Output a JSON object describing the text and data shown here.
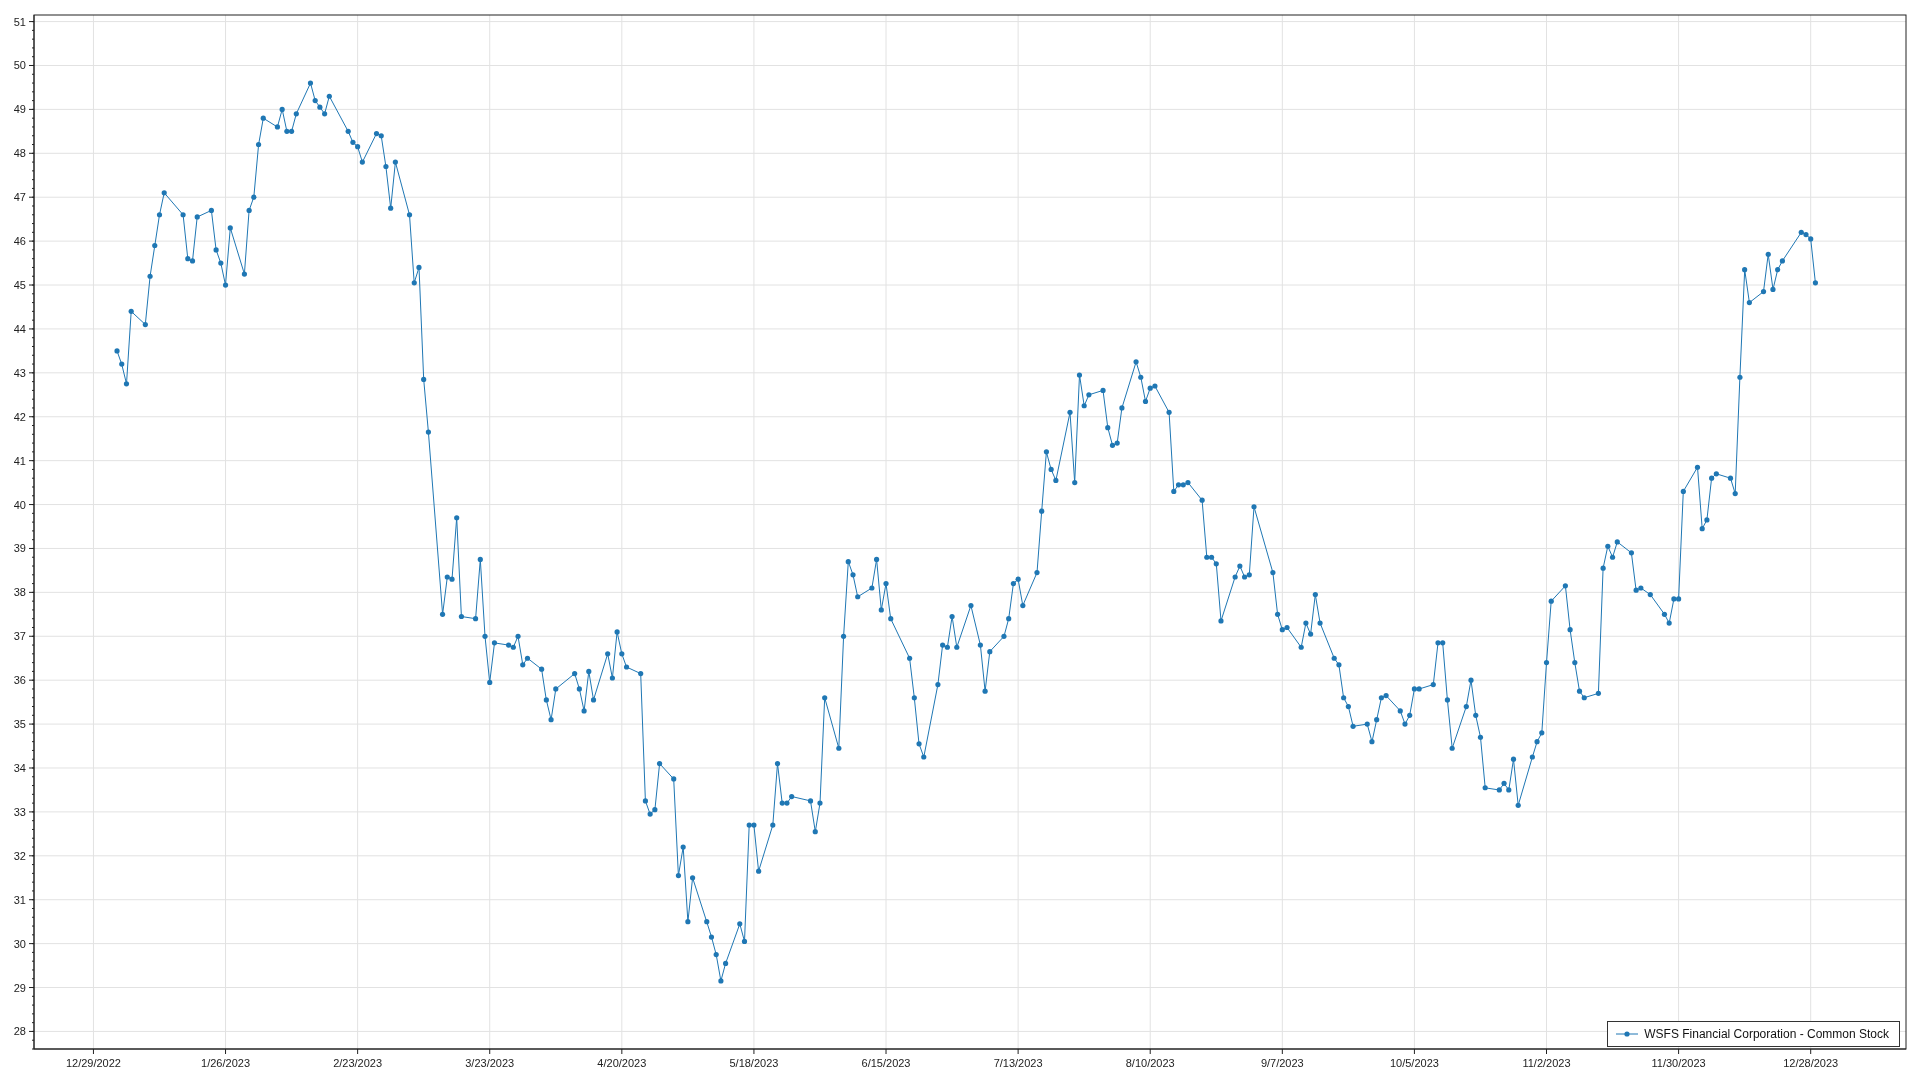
{
  "chart_data": {
    "type": "line",
    "x": [
      "2023-01-03",
      "2023-01-04",
      "2023-01-05",
      "2023-01-06",
      "2023-01-09",
      "2023-01-10",
      "2023-01-11",
      "2023-01-12",
      "2023-01-13",
      "2023-01-17",
      "2023-01-18",
      "2023-01-19",
      "2023-01-20",
      "2023-01-23",
      "2023-01-24",
      "2023-01-25",
      "2023-01-26",
      "2023-01-27",
      "2023-01-30",
      "2023-01-31",
      "2023-02-01",
      "2023-02-02",
      "2023-02-03",
      "2023-02-06",
      "2023-02-07",
      "2023-02-08",
      "2023-02-09",
      "2023-02-10",
      "2023-02-13",
      "2023-02-14",
      "2023-02-15",
      "2023-02-16",
      "2023-02-17",
      "2023-02-21",
      "2023-02-22",
      "2023-02-23",
      "2023-02-24",
      "2023-02-27",
      "2023-02-28",
      "2023-03-01",
      "2023-03-02",
      "2023-03-03",
      "2023-03-06",
      "2023-03-07",
      "2023-03-08",
      "2023-03-09",
      "2023-03-10",
      "2023-03-13",
      "2023-03-14",
      "2023-03-15",
      "2023-03-16",
      "2023-03-17",
      "2023-03-20",
      "2023-03-21",
      "2023-03-22",
      "2023-03-23",
      "2023-03-24",
      "2023-03-27",
      "2023-03-28",
      "2023-03-29",
      "2023-03-30",
      "2023-03-31",
      "2023-04-03",
      "2023-04-04",
      "2023-04-05",
      "2023-04-06",
      "2023-04-10",
      "2023-04-11",
      "2023-04-12",
      "2023-04-13",
      "2023-04-14",
      "2023-04-17",
      "2023-04-18",
      "2023-04-19",
      "2023-04-20",
      "2023-04-21",
      "2023-04-24",
      "2023-04-25",
      "2023-04-26",
      "2023-04-27",
      "2023-04-28",
      "2023-05-01",
      "2023-05-02",
      "2023-05-03",
      "2023-05-04",
      "2023-05-05",
      "2023-05-08",
      "2023-05-09",
      "2023-05-10",
      "2023-05-11",
      "2023-05-12",
      "2023-05-15",
      "2023-05-16",
      "2023-05-17",
      "2023-05-18",
      "2023-05-19",
      "2023-05-22",
      "2023-05-23",
      "2023-05-24",
      "2023-05-25",
      "2023-05-26",
      "2023-05-30",
      "2023-05-31",
      "2023-06-01",
      "2023-06-02",
      "2023-06-05",
      "2023-06-06",
      "2023-06-07",
      "2023-06-08",
      "2023-06-09",
      "2023-06-12",
      "2023-06-13",
      "2023-06-14",
      "2023-06-15",
      "2023-06-16",
      "2023-06-20",
      "2023-06-21",
      "2023-06-22",
      "2023-06-23",
      "2023-06-26",
      "2023-06-27",
      "2023-06-28",
      "2023-06-29",
      "2023-06-30",
      "2023-07-03",
      "2023-07-05",
      "2023-07-06",
      "2023-07-07",
      "2023-07-10",
      "2023-07-11",
      "2023-07-12",
      "2023-07-13",
      "2023-07-14",
      "2023-07-17",
      "2023-07-18",
      "2023-07-19",
      "2023-07-20",
      "2023-07-21",
      "2023-07-24",
      "2023-07-25",
      "2023-07-26",
      "2023-07-27",
      "2023-07-28",
      "2023-07-31",
      "2023-08-01",
      "2023-08-02",
      "2023-08-03",
      "2023-08-04",
      "2023-08-07",
      "2023-08-08",
      "2023-08-09",
      "2023-08-10",
      "2023-08-11",
      "2023-08-14",
      "2023-08-15",
      "2023-08-16",
      "2023-08-17",
      "2023-08-18",
      "2023-08-21",
      "2023-08-22",
      "2023-08-23",
      "2023-08-24",
      "2023-08-25",
      "2023-08-28",
      "2023-08-29",
      "2023-08-30",
      "2023-08-31",
      "2023-09-01",
      "2023-09-05",
      "2023-09-06",
      "2023-09-07",
      "2023-09-08",
      "2023-09-11",
      "2023-09-12",
      "2023-09-13",
      "2023-09-14",
      "2023-09-15",
      "2023-09-18",
      "2023-09-19",
      "2023-09-20",
      "2023-09-21",
      "2023-09-22",
      "2023-09-25",
      "2023-09-26",
      "2023-09-27",
      "2023-09-28",
      "2023-09-29",
      "2023-10-02",
      "2023-10-03",
      "2023-10-04",
      "2023-10-05",
      "2023-10-06",
      "2023-10-09",
      "2023-10-10",
      "2023-10-11",
      "2023-10-12",
      "2023-10-13",
      "2023-10-16",
      "2023-10-17",
      "2023-10-18",
      "2023-10-19",
      "2023-10-20",
      "2023-10-23",
      "2023-10-24",
      "2023-10-25",
      "2023-10-26",
      "2023-10-27",
      "2023-10-30",
      "2023-10-31",
      "2023-11-01",
      "2023-11-02",
      "2023-11-03",
      "2023-11-06",
      "2023-11-07",
      "2023-11-08",
      "2023-11-09",
      "2023-11-10",
      "2023-11-13",
      "2023-11-14",
      "2023-11-15",
      "2023-11-16",
      "2023-11-17",
      "2023-11-20",
      "2023-11-21",
      "2023-11-22",
      "2023-11-24",
      "2023-11-27",
      "2023-11-28",
      "2023-11-29",
      "2023-11-30",
      "2023-12-01",
      "2023-12-04",
      "2023-12-05",
      "2023-12-06",
      "2023-12-07",
      "2023-12-08",
      "2023-12-11",
      "2023-12-12",
      "2023-12-13",
      "2023-12-14",
      "2023-12-15",
      "2023-12-18",
      "2023-12-19",
      "2023-12-20",
      "2023-12-21",
      "2023-12-22",
      "2023-12-26",
      "2023-12-27",
      "2023-12-28",
      "2023-12-29"
    ],
    "series": [
      {
        "name": "WSFS Financial Corporation - Common Stock",
        "color": "#1f77b4",
        "values": [
          43.5,
          43.2,
          42.75,
          44.4,
          44.1,
          45.2,
          45.9,
          46.6,
          47.1,
          46.6,
          45.6,
          45.55,
          46.55,
          46.7,
          45.8,
          45.5,
          45.0,
          46.3,
          45.25,
          46.7,
          47.0,
          48.2,
          48.8,
          48.6,
          49.0,
          48.5,
          48.5,
          48.9,
          49.6,
          49.2,
          49.05,
          48.9,
          49.3,
          48.5,
          48.25,
          48.15,
          47.8,
          48.45,
          48.4,
          47.7,
          46.75,
          47.8,
          46.6,
          45.05,
          45.4,
          42.85,
          41.65,
          37.5,
          38.35,
          38.3,
          39.7,
          37.45,
          37.4,
          38.75,
          37.0,
          35.95,
          36.85,
          36.8,
          36.75,
          37.0,
          36.35,
          36.5,
          36.25,
          35.55,
          35.1,
          35.8,
          36.15,
          35.8,
          35.3,
          36.2,
          35.55,
          36.6,
          36.05,
          37.1,
          36.6,
          36.3,
          36.15,
          33.25,
          32.95,
          33.05,
          34.1,
          33.75,
          31.55,
          32.2,
          30.5,
          31.5,
          30.5,
          30.15,
          29.75,
          29.15,
          29.55,
          30.45,
          30.05,
          32.7,
          32.7,
          31.65,
          32.7,
          34.1,
          33.2,
          33.2,
          33.35,
          33.25,
          32.55,
          33.2,
          35.6,
          34.45,
          37.0,
          38.7,
          38.4,
          37.9,
          38.1,
          38.75,
          37.6,
          38.2,
          37.4,
          36.5,
          35.6,
          34.55,
          34.25,
          35.9,
          36.8,
          36.75,
          37.45,
          36.75,
          37.7,
          36.8,
          35.75,
          36.65,
          37.0,
          37.4,
          38.2,
          38.3,
          37.7,
          38.45,
          39.85,
          41.2,
          40.8,
          40.55,
          42.1,
          40.5,
          42.95,
          42.25,
          42.5,
          42.6,
          41.75,
          41.35,
          41.4,
          42.2,
          43.25,
          42.9,
          42.35,
          42.65,
          42.7,
          42.1,
          40.3,
          40.45,
          40.45,
          40.5,
          40.1,
          38.8,
          38.8,
          38.65,
          37.35,
          38.35,
          38.6,
          38.35,
          38.4,
          39.95,
          38.45,
          37.5,
          37.15,
          37.2,
          36.75,
          37.3,
          37.05,
          37.95,
          37.3,
          36.5,
          36.35,
          35.6,
          35.4,
          34.95,
          35.0,
          34.6,
          35.1,
          35.6,
          35.65,
          35.3,
          35.0,
          35.2,
          35.8,
          35.8,
          35.9,
          36.85,
          36.85,
          35.55,
          34.45,
          35.4,
          36.0,
          35.2,
          34.7,
          33.55,
          33.5,
          33.65,
          33.5,
          34.2,
          33.15,
          34.25,
          34.6,
          34.8,
          36.4,
          37.8,
          38.15,
          37.15,
          36.4,
          35.75,
          35.6,
          35.7,
          38.55,
          39.05,
          38.8,
          39.15,
          38.9,
          38.05,
          38.1,
          37.95,
          37.5,
          37.3,
          37.85,
          37.85,
          40.3,
          40.85,
          39.45,
          39.65,
          40.6,
          40.7,
          40.6,
          40.25,
          42.9,
          45.35,
          44.6,
          44.85,
          45.7,
          44.9,
          45.35,
          45.55,
          46.2,
          46.15,
          46.05,
          45.05
        ]
      }
    ],
    "xlim": [
      "2022-12-16T09:36:00Z",
      "2024-01-17T04:48:00Z"
    ],
    "ylim": [
      27.6,
      51.15
    ],
    "grid": true,
    "xticks": [
      {
        "value": "2022-12-29",
        "label": "12/29/2022"
      },
      {
        "value": "2023-01-26",
        "label": "1/26/2023"
      },
      {
        "value": "2023-02-23",
        "label": "2/23/2023"
      },
      {
        "value": "2023-03-23",
        "label": "3/23/2023"
      },
      {
        "value": "2023-04-20",
        "label": "4/20/2023"
      },
      {
        "value": "2023-05-18",
        "label": "5/18/2023"
      },
      {
        "value": "2023-06-15",
        "label": "6/15/2023"
      },
      {
        "value": "2023-07-13",
        "label": "7/13/2023"
      },
      {
        "value": "2023-08-10",
        "label": "8/10/2023"
      },
      {
        "value": "2023-09-07",
        "label": "9/7/2023"
      },
      {
        "value": "2023-10-05",
        "label": "10/5/2023"
      },
      {
        "value": "2023-11-02",
        "label": "11/2/2023"
      },
      {
        "value": "2023-11-30",
        "label": "11/30/2023"
      },
      {
        "value": "2023-12-28",
        "label": "12/28/2023"
      }
    ],
    "yticks": [
      28,
      29,
      30,
      31,
      32,
      33,
      34,
      35,
      36,
      37,
      38,
      39,
      40,
      41,
      42,
      43,
      44,
      45,
      46,
      47,
      48,
      49,
      50,
      51
    ]
  }
}
